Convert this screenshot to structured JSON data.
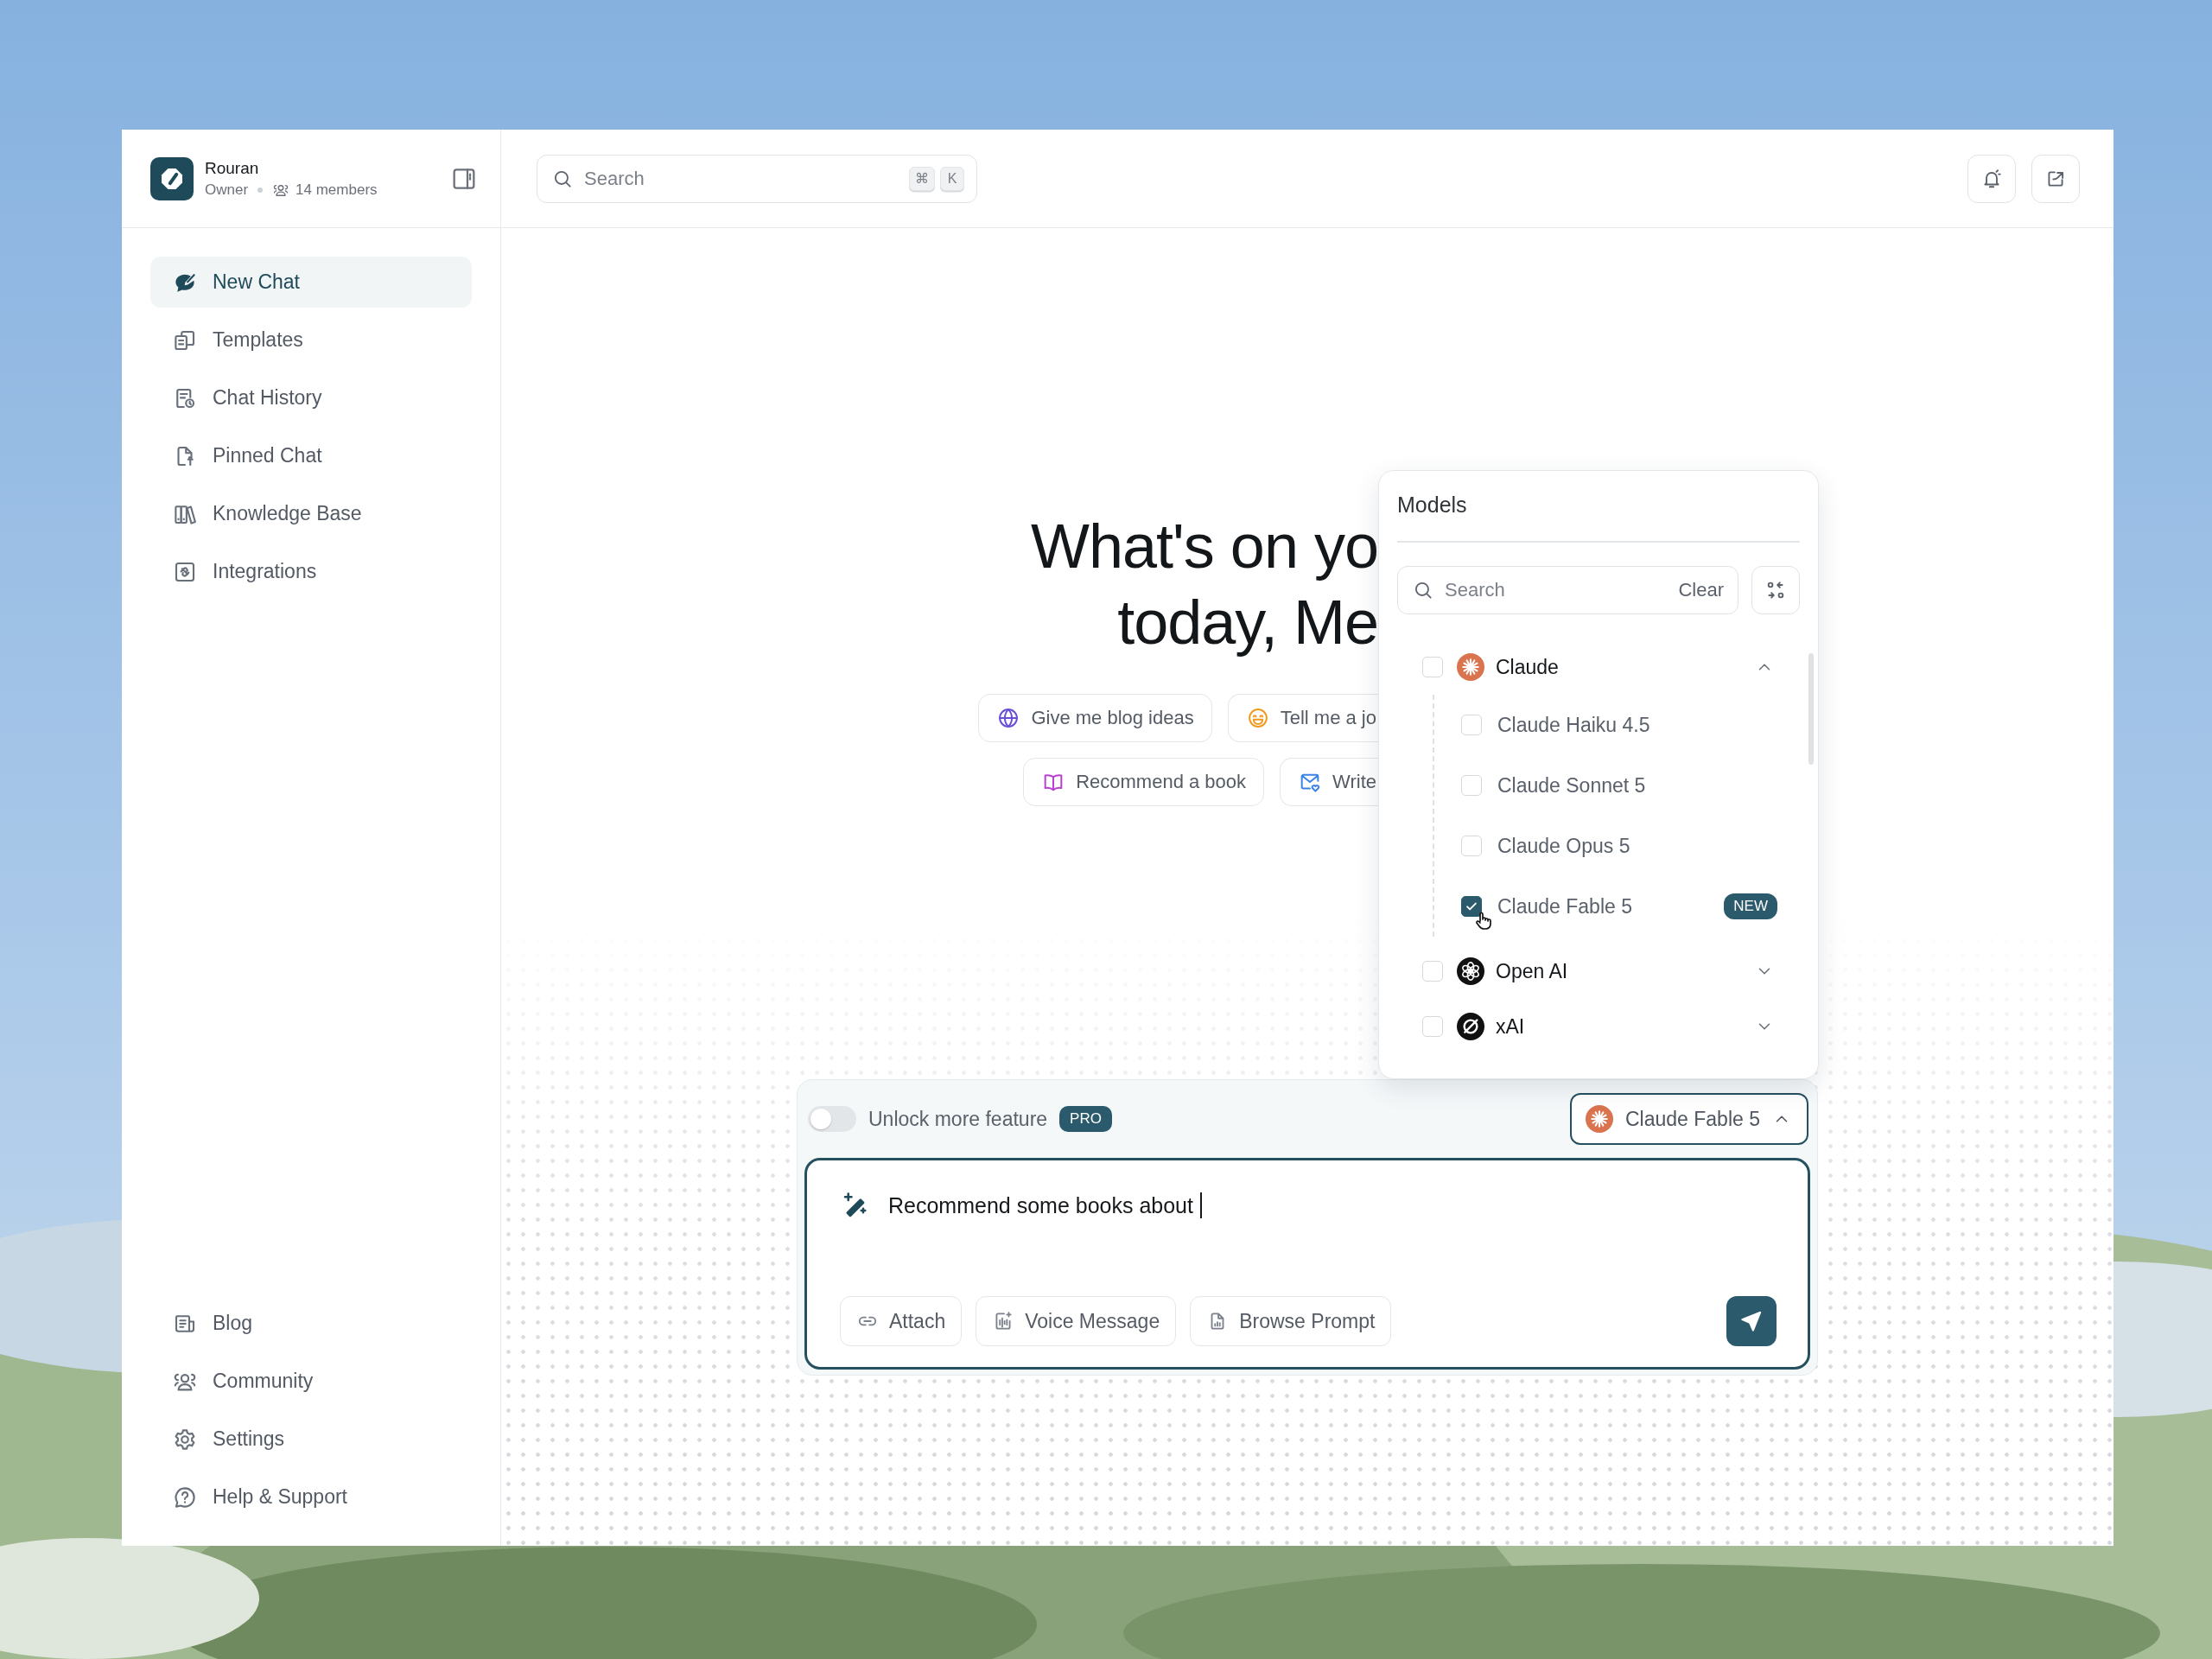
{
  "workspace": {
    "name": "Rouran",
    "role": "Owner",
    "members": "14 members"
  },
  "sidebar": {
    "items": [
      {
        "label": "New Chat",
        "selected": true
      },
      {
        "label": "Templates",
        "selected": false
      },
      {
        "label": "Chat History",
        "selected": false
      },
      {
        "label": "Pinned Chat",
        "selected": false
      },
      {
        "label": "Knowledge Base",
        "selected": false
      },
      {
        "label": "Integrations",
        "selected": false
      }
    ],
    "footer_items": [
      {
        "label": "Blog",
        "selected": false
      },
      {
        "label": "Community",
        "selected": false
      },
      {
        "label": "Settings",
        "selected": false
      },
      {
        "label": "Help & Support",
        "selected": false
      }
    ]
  },
  "topbar": {
    "search": {
      "placeholder": "Search",
      "shortcut": [
        "⌘",
        "K"
      ]
    }
  },
  "hero": {
    "headline": [
      "What's on yo",
      "today, Me"
    ],
    "suggestion_rows": [
      [
        "Give me blog ideas",
        "Tell me a jo"
      ],
      [
        "Recommend a book",
        "Write"
      ]
    ]
  },
  "composer": {
    "toggle": {
      "label": "Unlock more feature",
      "on": false
    },
    "badge": "PRO",
    "model_button": {
      "label": "Claude Fable 5",
      "expanded": true
    },
    "message": {
      "value": "Recommend some books about"
    },
    "actions": [
      "Attach",
      "Voice Message",
      "Browse Prompt"
    ]
  },
  "model_picker": {
    "title": "Models",
    "search": {
      "placeholder": "Search"
    },
    "clear": "Clear",
    "providers": [
      {
        "name": "Claude",
        "checked": false,
        "expanded": true,
        "children": [
          {
            "name": "Claude Haiku 4.5",
            "checked": false
          },
          {
            "name": "Claude Sonnet 5",
            "checked": false
          },
          {
            "name": "Claude Opus 5",
            "checked": false
          },
          {
            "name": "Claude Fable 5",
            "checked": true,
            "badge": "NEW"
          }
        ]
      },
      {
        "name": "Open AI",
        "checked": false,
        "expanded": false
      },
      {
        "name": "xAI",
        "checked": false,
        "expanded": false
      }
    ]
  }
}
